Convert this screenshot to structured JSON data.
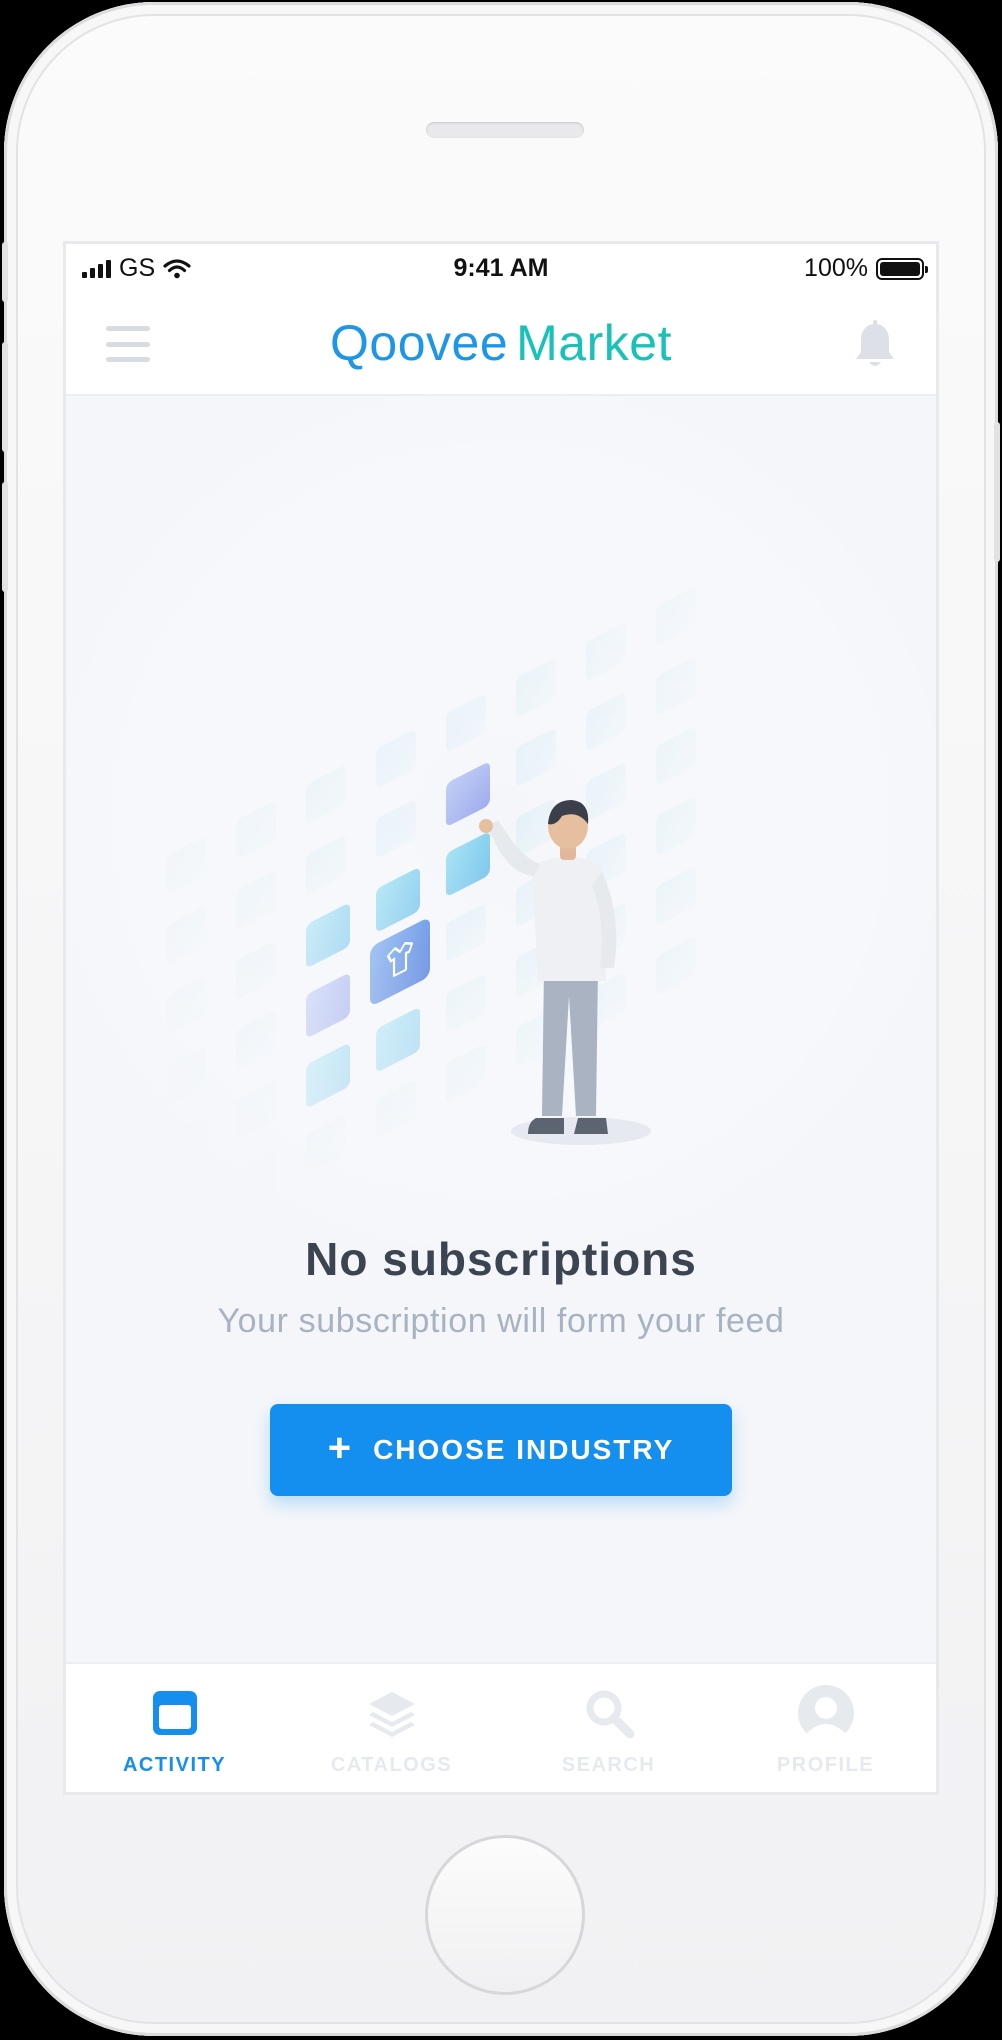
{
  "status_bar": {
    "carrier": "GS",
    "time": "9:41 AM",
    "battery": "100%"
  },
  "header": {
    "logo_primary": "Qoovee",
    "logo_secondary": "Market",
    "menu_icon": "hamburger-menu-icon",
    "notification_icon": "bell-icon"
  },
  "empty_state": {
    "title": "No subscriptions",
    "subtitle": "Your subscription will form your feed",
    "button_label": "CHOOSE INDUSTRY",
    "button_icon": "plus-icon",
    "illustration": "person-choosing-industry-tiles"
  },
  "tabs": [
    {
      "label": "ACTIVITY",
      "icon": "window-icon",
      "active": true
    },
    {
      "label": "CATALOGS",
      "icon": "layers-icon",
      "active": false
    },
    {
      "label": "SEARCH",
      "icon": "search-icon",
      "active": false
    },
    {
      "label": "PROFILE",
      "icon": "avatar-icon",
      "active": false
    }
  ],
  "colors": {
    "accent": "#148ff0",
    "logo_blue": "#1e96e8",
    "logo_teal": "#19c2b8",
    "title_text": "#3c4452",
    "subtitle_text": "#a8b3c2",
    "screen_background": "#f4f6fa"
  }
}
